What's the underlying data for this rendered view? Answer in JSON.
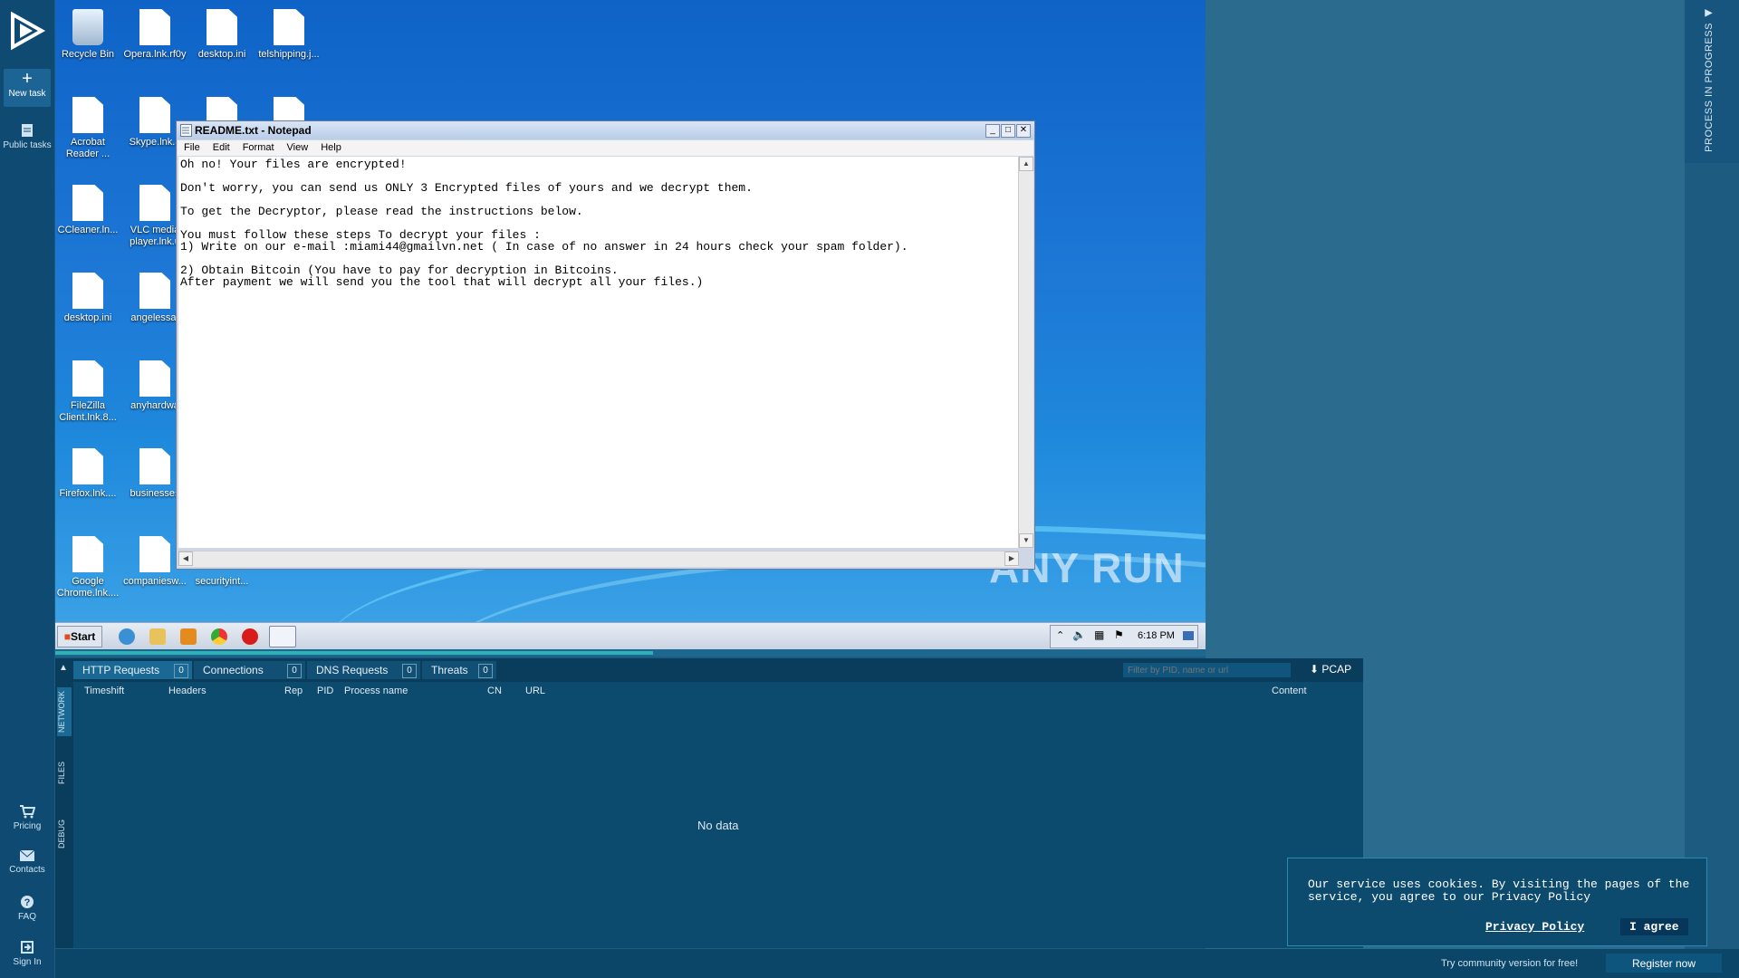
{
  "sidebar": {
    "new_task": "New task",
    "public_tasks": "Public tasks",
    "pricing": "Pricing",
    "contacts": "Contacts",
    "faq": "FAQ",
    "sign_in": "Sign In"
  },
  "desktop": {
    "icons": [
      {
        "label": "Recycle Bin"
      },
      {
        "label": "Opera.lnk.rf0y"
      },
      {
        "label": "desktop.ini"
      },
      {
        "label": "telshipping.j..."
      },
      {
        "label": "Acrobat Reader ..."
      },
      {
        "label": "Skype.lnk.3"
      },
      {
        "label": "CCleaner.ln..."
      },
      {
        "label": "VLC media player.lnk.u"
      },
      {
        "label": "desktop.ini"
      },
      {
        "label": "angelessaf"
      },
      {
        "label": "FileZilla Client.lnk.8..."
      },
      {
        "label": "anyhardwa"
      },
      {
        "label": "Firefox.lnk...."
      },
      {
        "label": "businesses"
      },
      {
        "label": "Google Chrome.lnk...."
      },
      {
        "label": "companiesw..."
      },
      {
        "label": "securityint..."
      }
    ],
    "watermark": "ANY RUN"
  },
  "notepad": {
    "title": "README.txt - Notepad",
    "menu": [
      "File",
      "Edit",
      "Format",
      "View",
      "Help"
    ],
    "content": "Oh no! Your files are encrypted!\n\nDon't worry, you can send us ONLY 3 Encrypted files of yours and we decrypt them.\n\nTo get the Decryptor, please read the instructions below.\n\nYou must follow these steps To decrypt your files :\n1) Write on our e-mail :miami44@gmailvn.net ( In case of no answer in 24 hours check your spam folder).\n\n2) Obtain Bitcoin (You have to pay for decryption in Bitcoins.\nAfter payment we will send you the tool that will decrypt all your files.)"
  },
  "taskbar": {
    "start": "Start",
    "clock": "6:18 PM"
  },
  "progress_strip": "PROCESS IN PROGRESS",
  "network": {
    "tabs": [
      {
        "label": "HTTP Requests",
        "count": "0"
      },
      {
        "label": "Connections",
        "count": "0"
      },
      {
        "label": "DNS Requests",
        "count": "0"
      },
      {
        "label": "Threats",
        "count": "0"
      }
    ],
    "filter_placeholder": "Filter by PID, name or url",
    "pcap": "PCAP",
    "columns": [
      "Timeshift",
      "Headers",
      "Rep",
      "PID",
      "Process name",
      "CN",
      "URL",
      "Content"
    ],
    "vtabs": [
      "NETWORK",
      "FILES",
      "DEBUG"
    ],
    "no_data": "No data"
  },
  "cookie": {
    "text": "Our service uses cookies. By visiting the pages of the service, you agree to our Privacy Policy",
    "privacy_link": "Privacy Policy",
    "agree": "I agree"
  },
  "footer": {
    "promo": "Try community version for free!",
    "register": "Register now"
  }
}
